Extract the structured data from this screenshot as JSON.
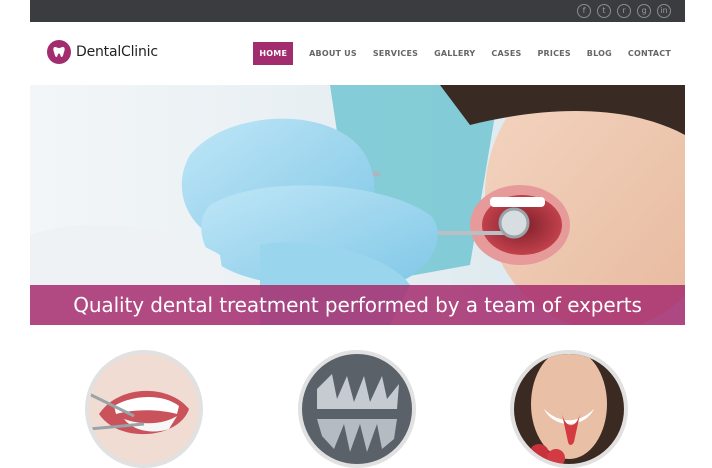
{
  "header": {
    "logo_text": "DentalClinic"
  },
  "nav": {
    "items": [
      {
        "label": "HOME",
        "active": true
      },
      {
        "label": "ABOUT US"
      },
      {
        "label": "SERVICES"
      },
      {
        "label": "GALLERY"
      },
      {
        "label": "CASES"
      },
      {
        "label": "PRICES"
      },
      {
        "label": "BLOG"
      },
      {
        "label": "CONTACT"
      }
    ]
  },
  "social": {
    "icons": [
      {
        "name": "facebook-icon",
        "glyph": "f"
      },
      {
        "name": "twitter-icon",
        "glyph": "t"
      },
      {
        "name": "rss-icon",
        "glyph": "r"
      },
      {
        "name": "google-plus-icon",
        "glyph": "g"
      },
      {
        "name": "linkedin-icon",
        "glyph": "in"
      }
    ]
  },
  "hero": {
    "tagline": "Quality dental treatment performed by a team of experts"
  },
  "features": {
    "items": [
      {
        "name": "feature-dental-tools-photo"
      },
      {
        "name": "feature-xray-photo"
      },
      {
        "name": "feature-smile-strawberry-photo"
      }
    ]
  },
  "colors": {
    "brand": "#a12d6e",
    "topbar": "#3b3c40"
  }
}
